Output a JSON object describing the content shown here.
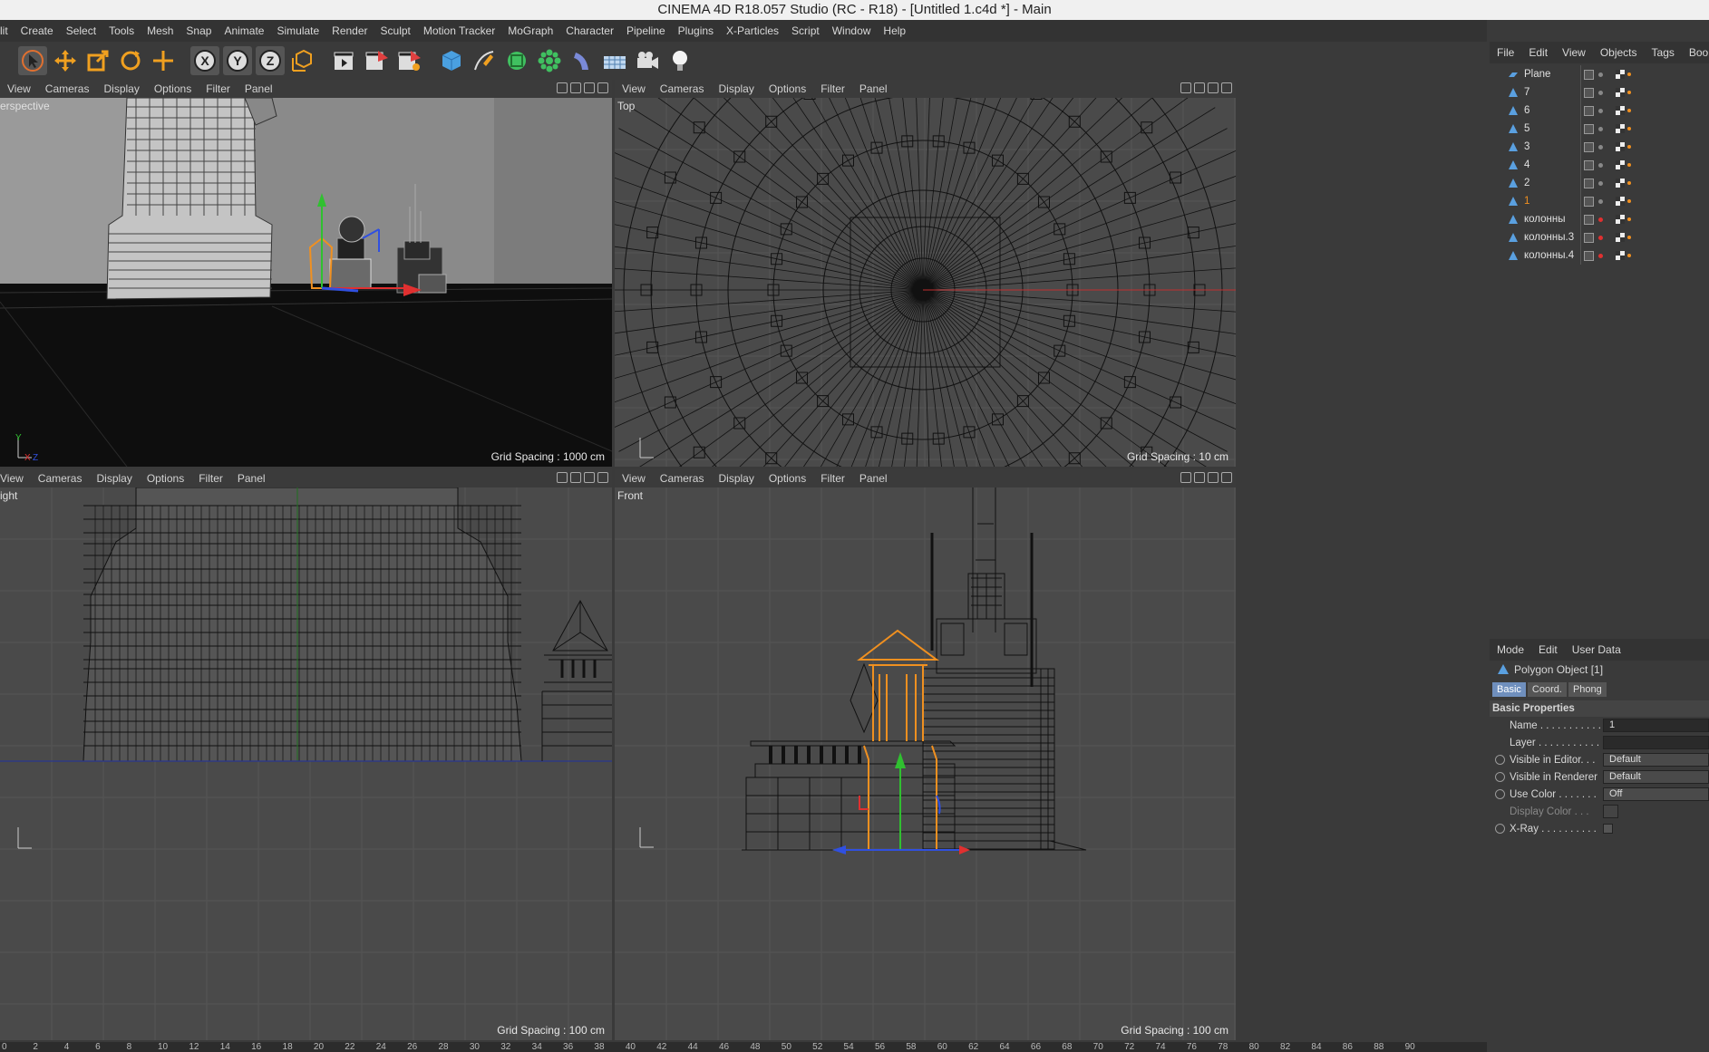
{
  "window": {
    "title": "CINEMA 4D R18.057 Studio (RC - R18) - [Untitled 1.c4d *] - Main"
  },
  "menu": [
    "lit",
    "Create",
    "Select",
    "Tools",
    "Mesh",
    "Snap",
    "Animate",
    "Simulate",
    "Render",
    "Sculpt",
    "Motion Tracker",
    "MoGraph",
    "Character",
    "Pipeline",
    "Plugins",
    "X-Particles",
    "Script",
    "Window",
    "Help"
  ],
  "viewport_menu": [
    "View",
    "Cameras",
    "Display",
    "Options",
    "Filter",
    "Panel"
  ],
  "viewports": {
    "perspective": {
      "name": "erspective",
      "grid": "Grid Spacing : 1000 cm"
    },
    "top": {
      "name": "Top",
      "grid": "Grid Spacing : 10 cm"
    },
    "right": {
      "name": "ight",
      "grid": "Grid Spacing : 100 cm"
    },
    "front": {
      "name": "Front",
      "grid": "Grid Spacing : 100 cm"
    }
  },
  "axis_labels": {
    "y": "Y",
    "z": "Z",
    "x": "X"
  },
  "object_manager": {
    "menu": [
      "File",
      "Edit",
      "View",
      "Objects",
      "Tags",
      "Boo"
    ],
    "objects": [
      {
        "name": "Plane",
        "selected": false
      },
      {
        "name": "7",
        "selected": false
      },
      {
        "name": "6",
        "selected": false
      },
      {
        "name": "5",
        "selected": false
      },
      {
        "name": "3",
        "selected": false
      },
      {
        "name": "4",
        "selected": false
      },
      {
        "name": "2",
        "selected": false
      },
      {
        "name": "1",
        "selected": true
      },
      {
        "name": "колонны",
        "selected": false
      },
      {
        "name": "колонны.3",
        "selected": false
      },
      {
        "name": "колонны.4",
        "selected": false
      }
    ]
  },
  "attributes": {
    "menu": [
      "Mode",
      "Edit",
      "User Data"
    ],
    "object_title": "Polygon Object [1]",
    "tabs": [
      "Basic",
      "Coord.",
      "Phong"
    ],
    "section": "Basic Properties",
    "fields": [
      {
        "label": "Name . . . . . . . . . . .",
        "value": "1",
        "radio": false,
        "dropdown": false
      },
      {
        "label": "Layer . . . . . . . . . . .",
        "value": "",
        "radio": false,
        "dropdown": false
      },
      {
        "label": "Visible in Editor. . .",
        "value": "Default",
        "radio": true,
        "dropdown": true
      },
      {
        "label": "Visible in Renderer",
        "value": "Default",
        "radio": true,
        "dropdown": true
      },
      {
        "label": "Use Color . . . . . . .",
        "value": "Off",
        "radio": true,
        "dropdown": true
      },
      {
        "label": "Display Color . . .",
        "value": "",
        "radio": false,
        "dropdown": false
      },
      {
        "label": "X-Ray . . . . . . . . . .",
        "value": "",
        "radio": true,
        "dropdown": false
      }
    ]
  },
  "timeline": [
    "0",
    "2",
    "4",
    "6",
    "8",
    "10",
    "12",
    "14",
    "16",
    "18",
    "20",
    "22",
    "24",
    "26",
    "28",
    "30",
    "32",
    "34",
    "36",
    "38",
    "40",
    "42",
    "44",
    "46",
    "48",
    "50",
    "52",
    "54",
    "56",
    "58",
    "60",
    "62",
    "64",
    "66",
    "68",
    "70",
    "72",
    "74",
    "76",
    "78",
    "80",
    "82",
    "84",
    "86",
    "88",
    "90"
  ],
  "colors": {
    "selection": "#f09020",
    "x_axis": "#e03030",
    "y_axis": "#30c030",
    "z_axis": "#3050e0"
  }
}
